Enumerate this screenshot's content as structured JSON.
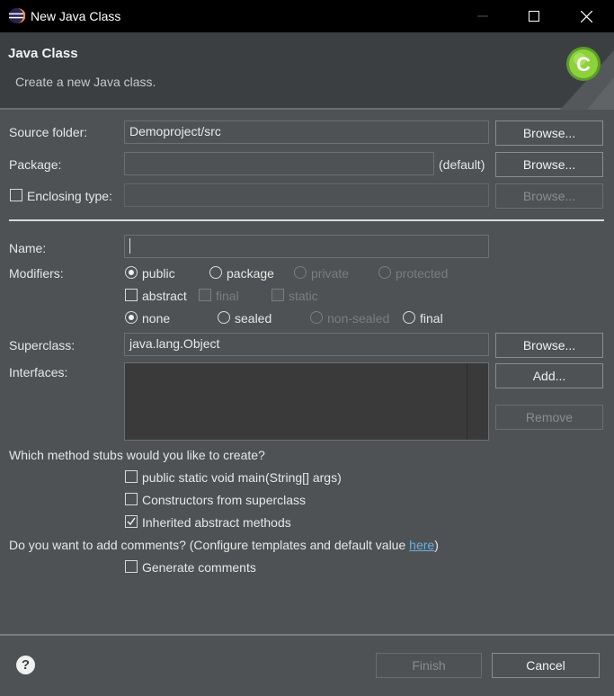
{
  "window": {
    "title": "New Java Class",
    "icons": [
      "eclipse-icon",
      "minimize-icon",
      "maximize-icon",
      "close-icon"
    ]
  },
  "header": {
    "title": "Java Class",
    "description": "Create a new Java class.",
    "art_icon": "new-class-wizard-icon"
  },
  "source_folder": {
    "label": "Source folder:",
    "value": "Demoproject/src",
    "button": "Browse..."
  },
  "package": {
    "label": "Package:",
    "value": "",
    "suffix": "(default)",
    "button": "Browse..."
  },
  "enclosing": {
    "label": "Enclosing type:",
    "value": "",
    "button": "Browse...",
    "checked": false
  },
  "name": {
    "label": "Name:",
    "value": ""
  },
  "modifiers": {
    "label": "Modifiers:",
    "access": [
      {
        "label": "public",
        "selected": true,
        "enabled": true
      },
      {
        "label": "package",
        "selected": false,
        "enabled": true
      },
      {
        "label": "private",
        "selected": false,
        "enabled": false
      },
      {
        "label": "protected",
        "selected": false,
        "enabled": false
      }
    ],
    "flags": [
      {
        "label": "abstract",
        "checked": false,
        "enabled": true
      },
      {
        "label": "final",
        "checked": false,
        "enabled": false
      },
      {
        "label": "static",
        "checked": false,
        "enabled": false
      }
    ],
    "sealing": [
      {
        "label": "none",
        "selected": true,
        "enabled": true
      },
      {
        "label": "sealed",
        "selected": false,
        "enabled": true
      },
      {
        "label": "non-sealed",
        "selected": false,
        "enabled": false
      },
      {
        "label": "final",
        "selected": false,
        "enabled": true
      }
    ]
  },
  "superclass": {
    "label": "Superclass:",
    "value": "java.lang.Object",
    "button": "Browse..."
  },
  "interfaces": {
    "label": "Interfaces:",
    "add_button": "Add...",
    "remove_button": "Remove"
  },
  "stubs": {
    "question": "Which method stubs would you like to create?",
    "options": [
      {
        "label": "public static void main(String[] args)",
        "checked": false
      },
      {
        "label": "Constructors from superclass",
        "checked": false
      },
      {
        "label": "Inherited abstract methods",
        "checked": true
      }
    ]
  },
  "comments": {
    "question": "Do you want to add comments? (Configure templates and default value ",
    "link": "here",
    "question_end": ")",
    "option": {
      "label": "Generate comments",
      "checked": false
    }
  },
  "footer": {
    "help_icon": "help-icon",
    "finish": "Finish",
    "cancel": "Cancel"
  }
}
